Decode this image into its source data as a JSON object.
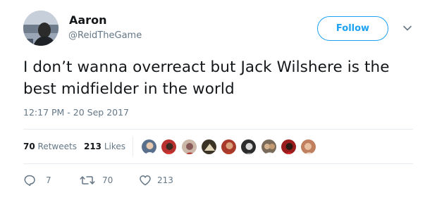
{
  "user": {
    "display_name": "Aaron",
    "handle": "@ReidTheGame",
    "avatar_icon": "profile-photo"
  },
  "follow_button": {
    "label": "Follow",
    "color": "#1da1f2"
  },
  "menu": {
    "icon": "chevron-down-icon"
  },
  "tweet": {
    "text": "I don’t wanna overreact but Jack Wilshere is the best midfielder in the world",
    "timestamp": "12:17 PM - 20 Sep 2017"
  },
  "stats": {
    "retweets_count": "70",
    "retweets_label": "Retweets",
    "likes_count": "213",
    "likes_label": "Likes"
  },
  "liker_avatars": [
    {
      "icon": "liker-avatar-1",
      "color": "#5a6f8c"
    },
    {
      "icon": "liker-avatar-2",
      "color": "#b8312f"
    },
    {
      "icon": "liker-avatar-3",
      "color": "#8a5a5a"
    },
    {
      "icon": "liker-avatar-4",
      "color": "#3b3326"
    },
    {
      "icon": "liker-avatar-5",
      "color": "#a83a2b"
    },
    {
      "icon": "liker-avatar-6",
      "color": "#2c2c2c"
    },
    {
      "icon": "liker-avatar-7",
      "color": "#7a6a5a"
    },
    {
      "icon": "liker-avatar-8",
      "color": "#9b1c1c"
    },
    {
      "icon": "liker-avatar-9",
      "color": "#c08060"
    }
  ],
  "actions": {
    "reply_count": "7",
    "retweet_count": "70",
    "like_count": "213"
  },
  "colors": {
    "text_primary": "#14171a",
    "text_secondary": "#657786",
    "accent": "#1da1f2",
    "divider": "#e6ecf0"
  }
}
